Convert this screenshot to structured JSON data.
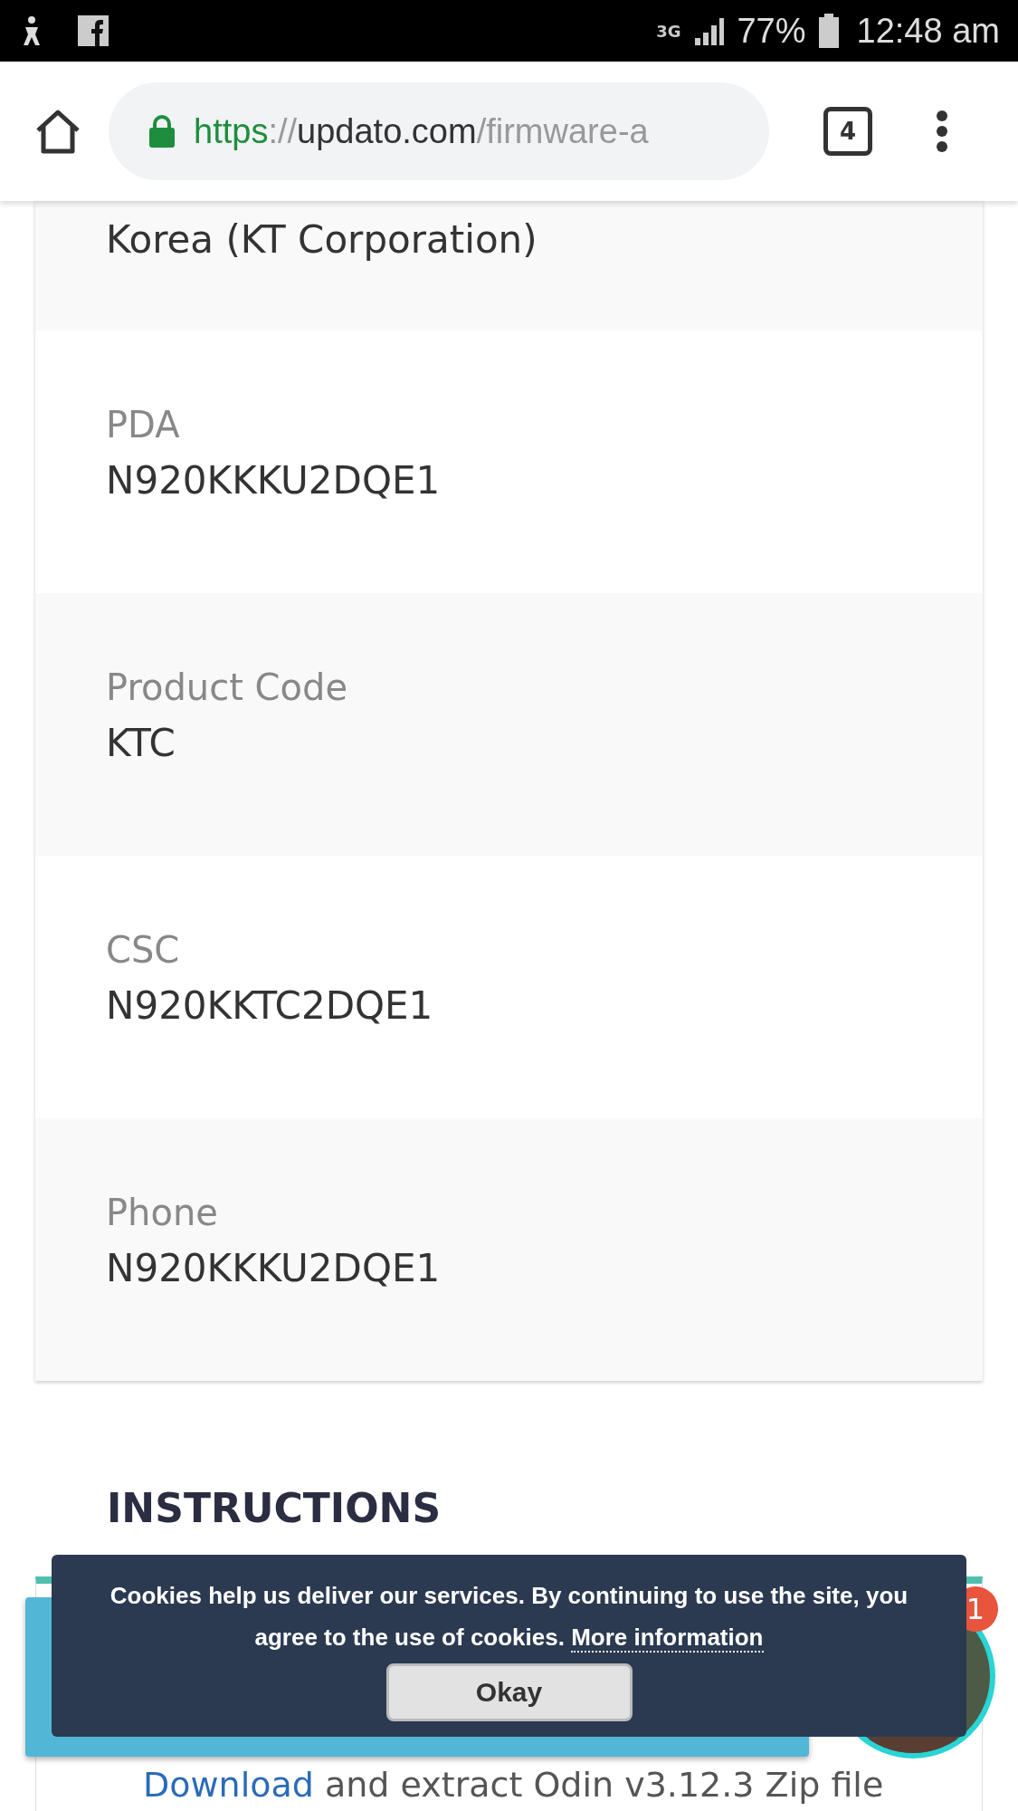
{
  "status_bar": {
    "network": "3G",
    "battery": "77%",
    "time": "12:48 am"
  },
  "toolbar": {
    "url_scheme": "https",
    "url_sep": "://",
    "url_host": "updato.com",
    "url_path": "/firmware-a",
    "tab_count": "4"
  },
  "details": [
    {
      "value": "Korea (KT Corporation)"
    },
    {
      "label": "PDA",
      "value": "N920KKKU2DQE1"
    },
    {
      "label": "Product Code",
      "value": "KTC"
    },
    {
      "label": "CSC",
      "value": "N920KKTC2DQE1"
    },
    {
      "label": "Phone",
      "value": "N920KKKU2DQE1"
    }
  ],
  "instructions": {
    "heading": "INSTRUCTIONS",
    "step_link": "Download",
    "step_text": "and extract Odin v3.12.3 Zip file"
  },
  "cookie_banner": {
    "text": "Cookies help us deliver our services. By continuing to use the site, you agree to the use of cookies.",
    "link": "More information",
    "button": "Okay"
  },
  "chat": {
    "badge": "1"
  }
}
